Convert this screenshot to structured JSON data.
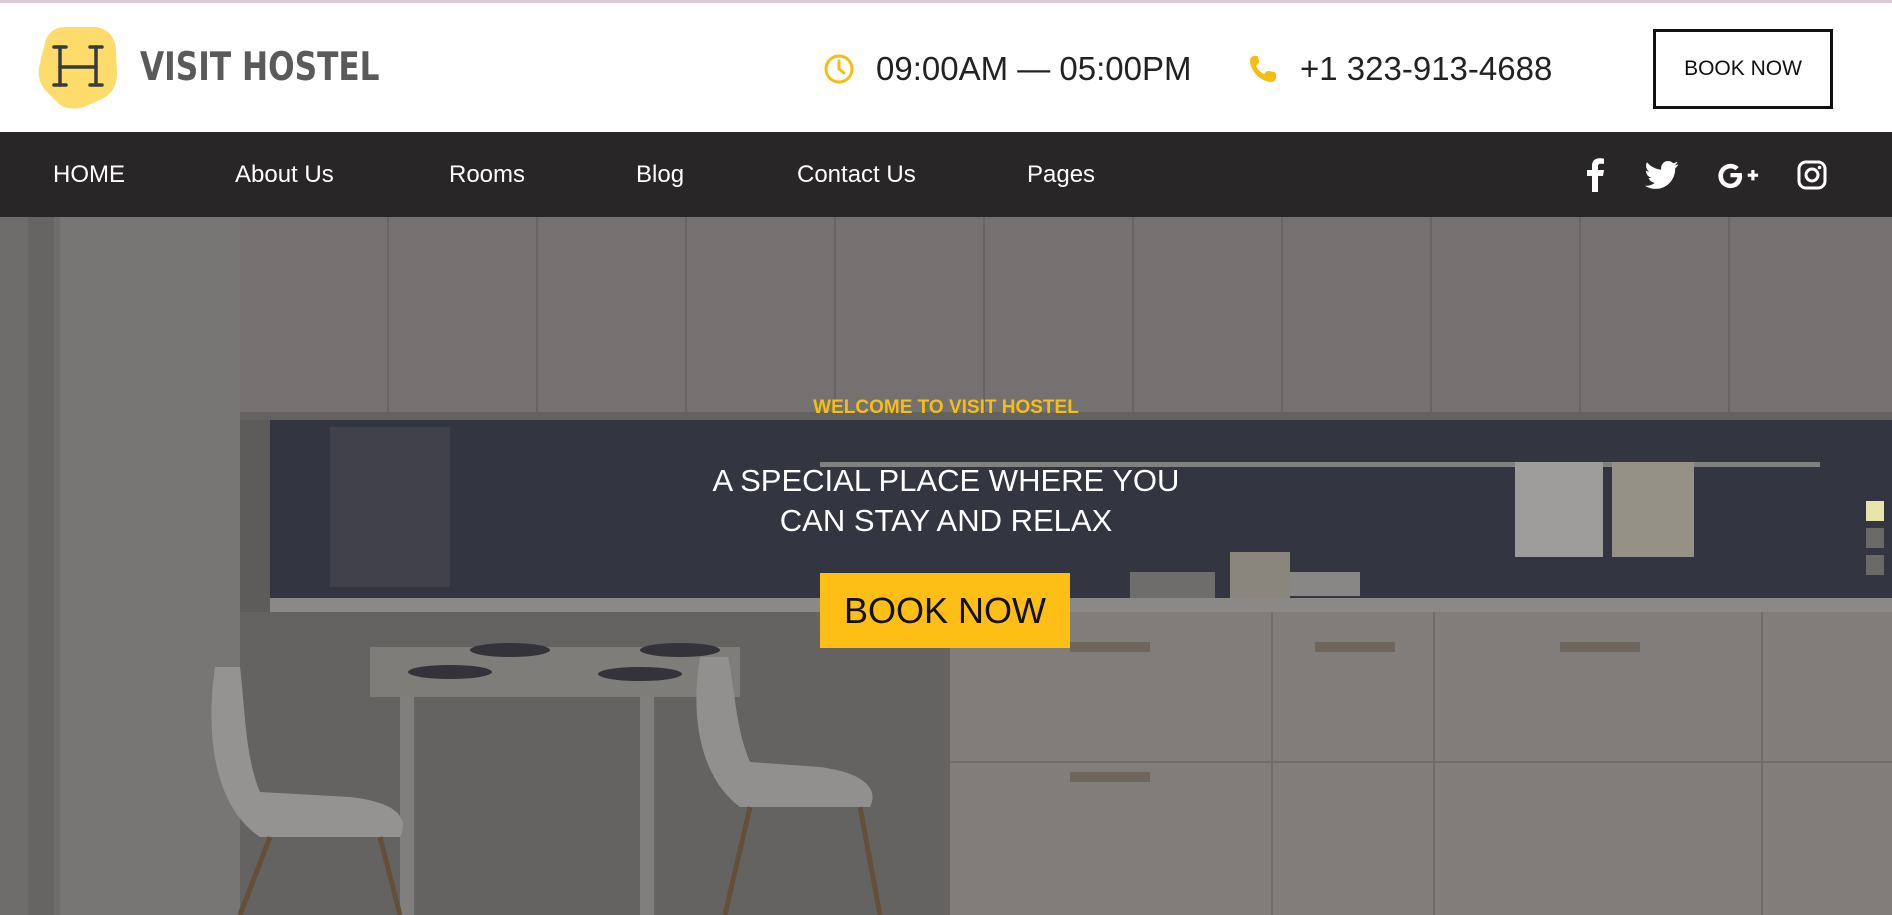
{
  "header": {
    "logo_text": "VISIT HOSTEL",
    "logo_icon": "hostel-bed-icon",
    "hours": "09:00AM — 05:00PM",
    "hours_icon": "clock-icon",
    "phone": "+1 323-913-4688",
    "phone_icon": "phone-icon",
    "book_label": "BOOK NOW"
  },
  "nav": {
    "items": [
      {
        "label": "HOME"
      },
      {
        "label": "About Us"
      },
      {
        "label": "Rooms"
      },
      {
        "label": "Blog"
      },
      {
        "label": "Contact Us"
      },
      {
        "label": "Pages"
      }
    ],
    "social": [
      "facebook-icon",
      "twitter-icon",
      "google-plus-icon",
      "instagram-icon"
    ]
  },
  "hero": {
    "welcome": "WELCOME TO VISIT HOSTEL",
    "headline_line1": "A SPECIAL PLACE WHERE YOU",
    "headline_line2": "CAN STAY AND RELAX",
    "cta_label": "BOOK NOW",
    "slides": 3,
    "active_slide": 1
  },
  "colors": {
    "accent": "#fdbf15",
    "accent_text": "#f6be12",
    "nav_bg": "#282627",
    "logo_badge": "#fddc6b"
  }
}
